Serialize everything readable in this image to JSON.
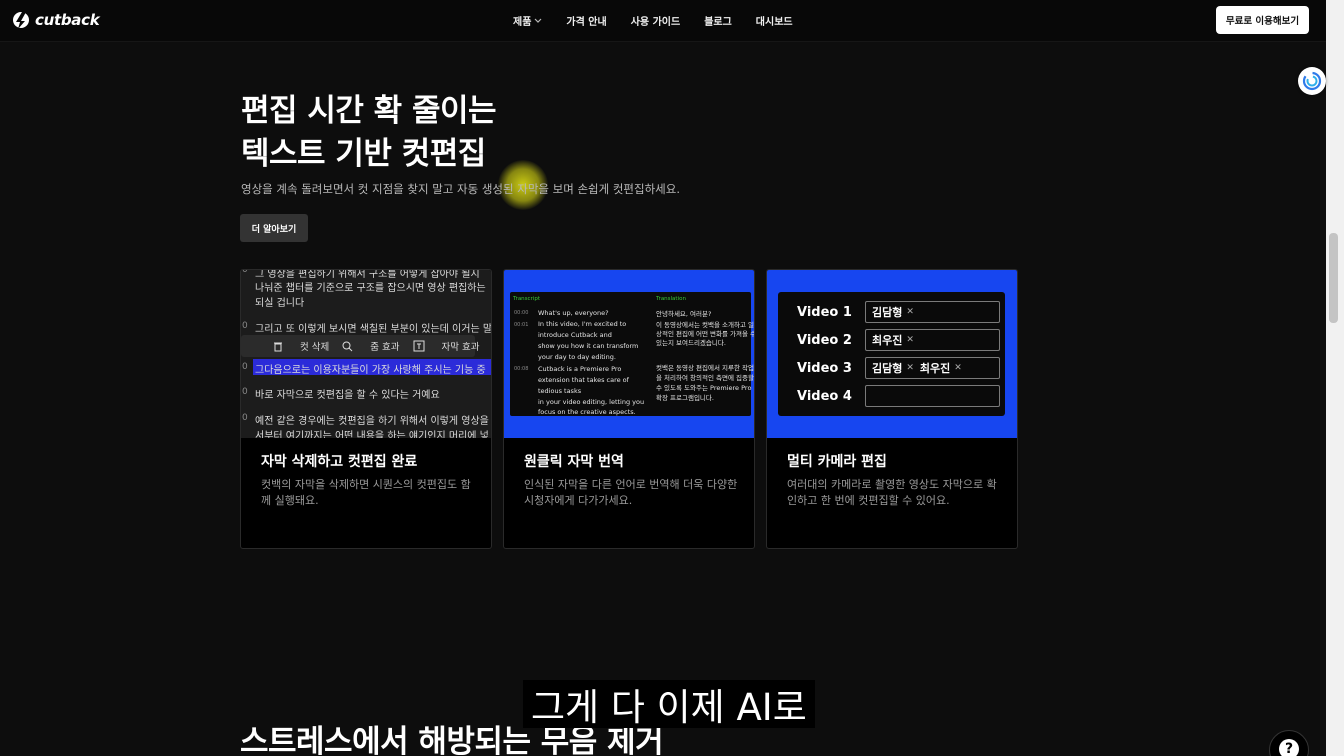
{
  "nav": {
    "logo": "cutback",
    "items": [
      {
        "label": "제품",
        "has_dropdown": true
      },
      {
        "label": "가격 안내"
      },
      {
        "label": "사용 가이드"
      },
      {
        "label": "블로그"
      },
      {
        "label": "대시보드"
      }
    ],
    "cta": "무료로 이용해보기"
  },
  "hero": {
    "title_line1": "편집 시간 확 줄이는",
    "title_line2": "텍스트 기반 컷편집",
    "subtitle": "영상을 계속 돌려보면서 컷 지점을 찾지 말고 자동 생성된 자막을 보며 손쉽게 컷편집하세요.",
    "button": "더 알아보기"
  },
  "cards": [
    {
      "title": "자막 삭제하고 컷편집 완료",
      "desc": "컷백의 자막을 삭제하면 시퀀스의 컷편집도 함께 실행돼요.",
      "transcript": {
        "lines": [
          "그 영상을 편집하기 위해서 구조를 어떻게 잡아야 될지",
          "나눠준 챕터를 기준으로 구조를 잡으시면 영상 편집하는",
          "되실 겁니다",
          "그리고 또 이렇게 보시면 색칠된 부분이 있는데 이거는 말",
          "그다음으로는 이용자분들이 가장 사랑해 주시는 기능 중",
          "바로 자막으로 컷편집을 할 수 있다는 거예요",
          "예전 같은 경우에는 컷편집을 하기 위해서 이렇게 영상을",
          "서부터 여기까지는 어떤 내용을 하는 얘기인지 머리에 넣"
        ],
        "toolbar": {
          "cut": "컷 삭제",
          "zoom": "줌 효과",
          "caption": "자막 효과"
        }
      }
    },
    {
      "title": "원클릭 자막 번역",
      "desc": "인식된 자막을 다른 언어로 번역해 더욱 다양한 시청자에게 다가가세요.",
      "panel": {
        "transcript_label": "Transcript",
        "translation_label": "Translation",
        "timecodes": [
          "00:00",
          "00:01",
          "00:08"
        ],
        "en_lines": [
          "What's up, everyone?",
          "In this video, I'm excited to",
          "introduce Cutback and",
          "show you how it can transform",
          "your day to day editing.",
          "Cutback is a Premiere Pro",
          "extension that takes care of",
          "tedious tasks",
          "in your video editing, letting you",
          "focus on the creative aspects."
        ],
        "ko_lines": [
          "안녕하세요, 여러분?",
          "이 동영상에서는 컷백을 소개하고 일",
          "상적인 편집에 어떤 변화를 가져올 수",
          "있는지 보여드리겠습니다.",
          "컷백은 동영상 편집에서 지루한 작업",
          "을 처리하여 창의적인 측면에 집중할",
          "수 있도록 도와주는 Premiere Pro",
          "확장 프로그램입니다."
        ]
      }
    },
    {
      "title": "멀티 카메라 편집",
      "desc": "여러대의 카메라로 촬영한 영상도 자막으로 확인하고 한 번에 컷편집할 수 있어요.",
      "videos": [
        {
          "label": "Video 1",
          "chips": [
            "김담형"
          ]
        },
        {
          "label": "Video 2",
          "chips": [
            "최우진"
          ]
        },
        {
          "label": "Video 3",
          "chips": [
            "김담형",
            "최우진"
          ]
        },
        {
          "label": "Video 4",
          "chips": []
        }
      ]
    }
  ],
  "next_section_title": "스트레스에서 해방되는 무음 제거",
  "video_caption": "그게 다 이제 AI로",
  "help": "?",
  "colors": {
    "accent_blue": "#1746f0",
    "selection": "#2b2bd9",
    "highlight": "#ebeb14"
  }
}
